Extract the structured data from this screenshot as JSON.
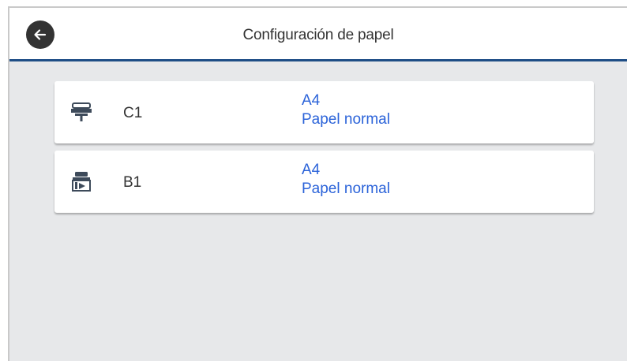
{
  "header": {
    "title": "Configuración de papel",
    "back_icon": "arrow-left-icon"
  },
  "paper_sources": [
    {
      "source": "C1",
      "icon": "roll-paper-feeder-icon",
      "size": "A4",
      "type": "Papel normal"
    },
    {
      "source": "B1",
      "icon": "manual-feed-tray-icon",
      "size": "A4",
      "type": "Papel normal"
    }
  ],
  "colors": {
    "accent_text": "#2b63d9",
    "header_border": "#1f4e86",
    "background": "#e7e8ea"
  }
}
